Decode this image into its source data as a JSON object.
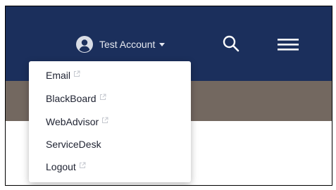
{
  "header": {
    "account": {
      "name": "Test Account",
      "icon": "user-circle-icon",
      "caret_icon": "caret-down-icon"
    },
    "search": {
      "icon": "search-icon"
    },
    "menu": {
      "icon": "hamburger-menu-icon"
    }
  },
  "account_menu": {
    "items": [
      {
        "label": "Email",
        "external": true
      },
      {
        "label": "BlackBoard",
        "external": true
      },
      {
        "label": "WebAdvisor",
        "external": true
      },
      {
        "label": "ServiceDesk",
        "external": false
      },
      {
        "label": "Logout",
        "external": true
      }
    ]
  },
  "colors": {
    "navbar": "#1b2f5c",
    "banner": "#736860",
    "menu_text": "#202433",
    "external_icon": "#c5c8cf",
    "header_icon": "#ffffff"
  }
}
